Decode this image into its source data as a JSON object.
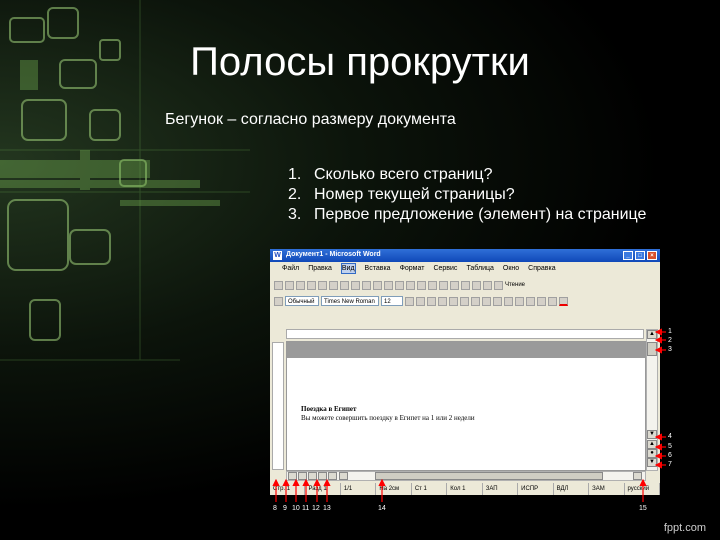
{
  "slide": {
    "title": "Полосы прокрутки",
    "subtitle": "Бегунок – согласно размеру документа",
    "questions": [
      {
        "num": "1.",
        "text": "Сколько всего страниц?"
      },
      {
        "num": "2.",
        "text": "Номер текущей страницы?"
      },
      {
        "num": "3.",
        "text": "Первое предложение (элемент) на странице"
      }
    ],
    "brand": "fppt.com"
  },
  "word": {
    "window_title": "Документ1 - Microsoft Word",
    "menu": [
      "Файл",
      "Правка",
      "Вид",
      "Вставка",
      "Формат",
      "Сервис",
      "Таблица",
      "Окно",
      "Справка"
    ],
    "style_combo": "Обычный",
    "font_combo": "Times New Roman",
    "size_combo": "12",
    "reading_label": "Чтение",
    "doc_heading": "Поездка в Египет",
    "doc_text": "Вы можете совершить поездку в Египет на 1 или 2 недели",
    "status": [
      "Стр. 1",
      "Разд 1",
      "1/1",
      "На 2см",
      "Ст 1",
      "Кол 1",
      "ЗАП",
      "ИСПР",
      "ВДЛ",
      "ЗАМ",
      "русский (Ро"
    ]
  },
  "callouts": {
    "right": [
      "1",
      "2",
      "3",
      "4",
      "5",
      "6",
      "7"
    ],
    "bottom": [
      "8",
      "9",
      "10",
      "11",
      "12",
      "13",
      "14",
      "15"
    ]
  },
  "colors": {
    "arrow": "#ff0000",
    "title_bar": "#1e4cc0"
  }
}
